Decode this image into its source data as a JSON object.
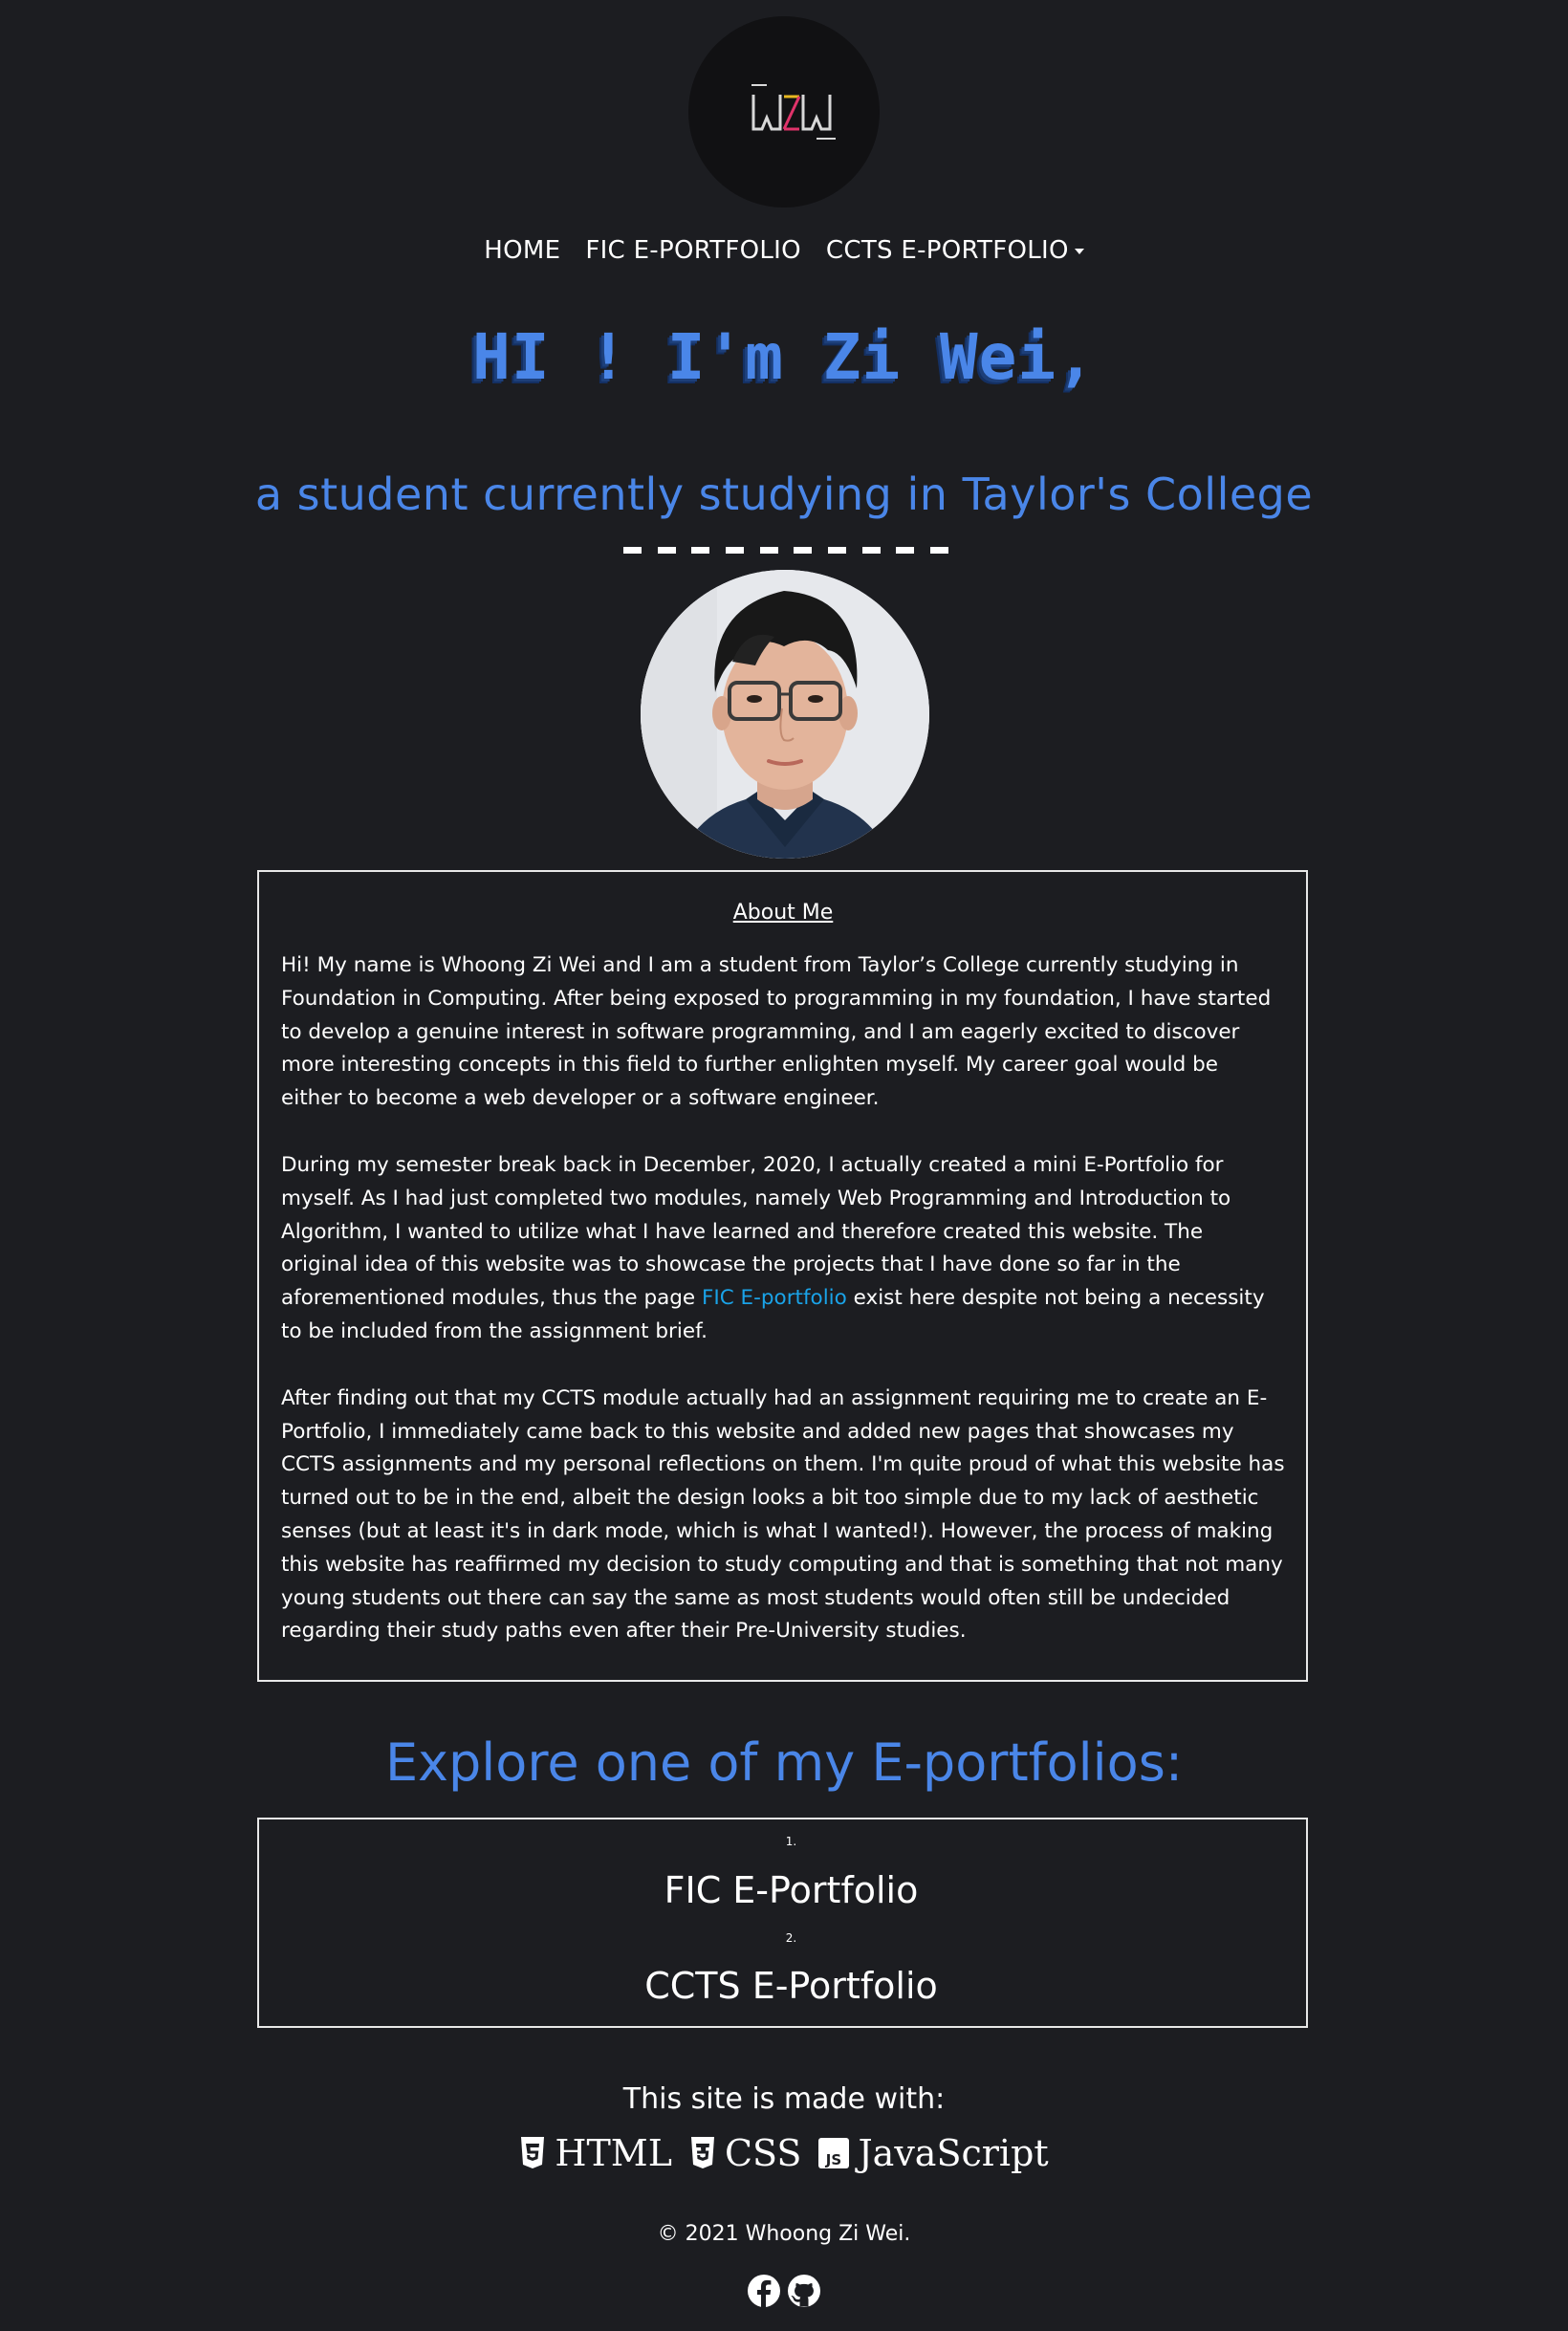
{
  "logo": {
    "text": "WZW",
    "icon": "wzw-logo"
  },
  "nav": {
    "items": [
      {
        "label": "HOME"
      },
      {
        "label": "FIC E-PORTFOLIO"
      },
      {
        "label": "CCTS E-PORTFOLIO"
      }
    ]
  },
  "hero": {
    "title": "HI ! I'm Zi Wei,",
    "subtitle": "a student currently studying in Taylor's College"
  },
  "about": {
    "title": "About Me",
    "p1": "Hi! My name is Whoong Zi Wei and I am a student from Taylor’s College currently studying in Foundation in Computing. After being exposed to programming in my foundation, I have started to develop a genuine interest in software programming, and I am eagerly excited to discover more interesting concepts in this field to further enlighten myself. My career goal would be either to become a web developer or a software engineer.",
    "p2_before": "During my semester break back in December, 2020, I actually created a mini E-Portfolio for myself. As I had just completed two modules, namely Web Programming and Introduction to Algorithm, I wanted to utilize what I have learned and therefore created this website. The original idea of this website was to showcase the projects that I have done so far in the aforementioned modules, thus the page ",
    "p2_link": "FIC E-portfolio",
    "p2_after": " exist here despite not being a necessity to be included from the assignment brief.",
    "p3": "After finding out that my CCTS module actually had an assignment requiring me to create an E-Portfolio, I immediately came back to this website and added new pages that showcases my CCTS assignments and my personal reflections on them. I'm quite proud of what this website has turned out to be in the end, albeit the design looks a bit too simple due to my lack of aesthetic senses (but at least it's in dark mode, which is what I wanted!). However, the process of making this website has reaffirmed my decision to study computing and that is something that not many young students out there can say the same as most students would often still be undecided regarding their study paths even after their Pre-University studies.",
    "link_color": "#1aa3e8"
  },
  "explore": {
    "title": "Explore one of my E-portfolios:",
    "items": [
      {
        "num": "1.",
        "label": "FIC E-Portfolio"
      },
      {
        "num": "2.",
        "label": "CCTS E-Portfolio"
      }
    ]
  },
  "footer": {
    "made_with": "This site is made with:",
    "tech": [
      {
        "icon": "html5-icon",
        "label": "HTML"
      },
      {
        "icon": "css3-icon",
        "label": "CSS"
      },
      {
        "icon": "javascript-icon",
        "label": "JavaScript"
      }
    ],
    "copyright": "© 2021 Whoong Zi Wei.",
    "social": [
      {
        "icon": "facebook-icon"
      },
      {
        "icon": "github-icon"
      }
    ]
  },
  "colors": {
    "background": "#1c1d21",
    "accent": "#4a86e8",
    "text": "#ffffff"
  }
}
